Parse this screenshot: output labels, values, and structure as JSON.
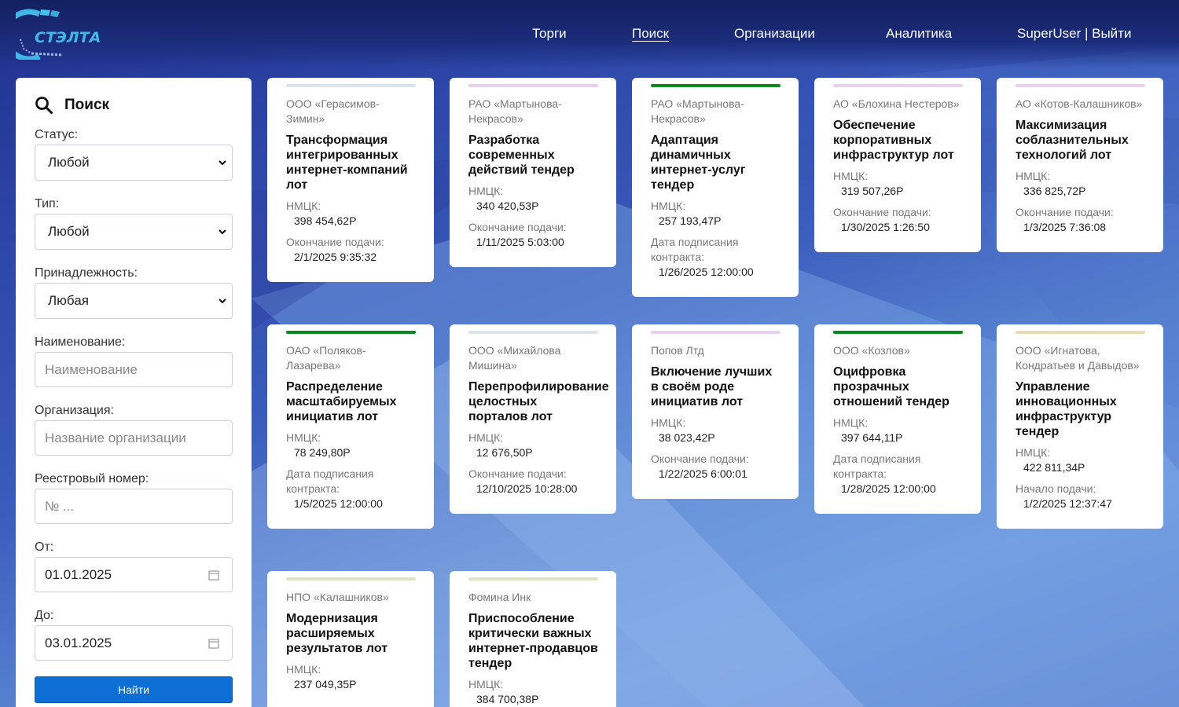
{
  "brand": {
    "name": "СТЭЛТА"
  },
  "nav": {
    "items": [
      "Торги",
      "Поиск",
      "Организации",
      "Аналитика",
      "SuperUser | Выйти"
    ],
    "active": "Поиск"
  },
  "search": {
    "title": "Поиск",
    "status_label": "Статус:",
    "status_value": "Любой",
    "type_label": "Тип:",
    "type_value": "Любой",
    "affiliation_label": "Принадлежность:",
    "affiliation_value": "Любая",
    "name_label": "Наименование:",
    "name_placeholder": "Наименование",
    "org_label": "Организация:",
    "org_placeholder": "Название организации",
    "reg_label": "Реестровый номер:",
    "reg_placeholder": "№ ...",
    "from_label": "От:",
    "from_value": "01.01.2025",
    "to_label": "До:",
    "to_value": "03.01.2025",
    "submit": "Найти"
  },
  "cards": [
    {
      "bar_color": "#dbe3ec",
      "org": "ООО «Герасимов-Зимин»",
      "title": "Трансформация интегрированных интернет-компаний лот",
      "price_label": "НМЦК:",
      "price": "398 454,62Р",
      "date_label": "Окончание подачи:",
      "date": "2/1/2025 9:35:32"
    },
    {
      "bar_color": "#e6d0ec",
      "org": "РАО «Мартынова-Некрасов»",
      "title": "Разработка современных действий тендер",
      "price_label": "НМЦК:",
      "price": "340 420,53Р",
      "date_label": "Окончание подачи:",
      "date": "1/11/2025 5:03:00"
    },
    {
      "bar_color": "#0a8a1e",
      "org": "РАО «Мартынова-Некрасов»",
      "title": "Адаптация динамичных интернет-услуг тендер",
      "price_label": "НМЦК:",
      "price": "257 193,47Р",
      "date_label": "Дата подписания контракта:",
      "date": "1/26/2025 12:00:00"
    },
    {
      "bar_color": "#e6d0ec",
      "org": "АО «Блохина Нестеров»",
      "title": "Обеспечение корпоративных инфраструктур лот",
      "price_label": "НМЦК:",
      "price": "319 507,26Р",
      "date_label": "Окончание подачи:",
      "date": "1/30/2025 1:26:50"
    },
    {
      "bar_color": "#e6d0ec",
      "org": "АО «Котов-Калашников»",
      "title": "Максимизация соблазнительных технологий лот",
      "price_label": "НМЦК:",
      "price": "336 825,72Р",
      "date_label": "Окончание подачи:",
      "date": "1/3/2025 7:36:08"
    },
    {
      "bar_color": "#0a8a1e",
      "org": "ОАО «Поляков-Лазарева»",
      "title": "Распределение масштабируемых инициатив лот",
      "price_label": "НМЦК:",
      "price": "78 249,80Р",
      "date_label": "Дата подписания контракта:",
      "date": "1/5/2025 12:00:00"
    },
    {
      "bar_color": "#dbe3ec",
      "org": "ООО «Михайлова Мишина»",
      "title": "Перепрофилирование целостных порталов лот",
      "price_label": "НМЦК:",
      "price": "12 676,50Р",
      "date_label": "Окончание подачи:",
      "date": "12/10/2025 10:28:00"
    },
    {
      "bar_color": "#e6d0ec",
      "org": "Попов Лтд",
      "title": "Включение лучших в своём роде инициатив лот",
      "price_label": "НМЦК:",
      "price": "38 023,42Р",
      "date_label": "Окончание подачи:",
      "date": "1/22/2025 6:00:01"
    },
    {
      "bar_color": "#0a8a1e",
      "org": "ООО «Козлов»",
      "title": "Оцифровка прозрачных отношений тендер",
      "price_label": "НМЦК:",
      "price": "397 644,11Р",
      "date_label": "Дата подписания контракта:",
      "date": "1/28/2025 12:00:00"
    },
    {
      "bar_color": "#e6dcb4",
      "org": "ООО «Игнатова, Кондратьев и Давыдов»",
      "title": "Управление инновационных инфраструктур тендер",
      "price_label": "НМЦК:",
      "price": "422 811,34Р",
      "date_label": "Начало подачи:",
      "date": "1/2/2025 12:37:47"
    },
    {
      "bar_color": "#dde6c0",
      "org": "НПО «Калашников»",
      "title": "Модернизация расширяемых результатов лот",
      "price_label": "НМЦК:",
      "price": "237 049,35Р",
      "date_label": "",
      "date": ""
    },
    {
      "bar_color": "#dde6c0",
      "org": "Фомина Инк",
      "title": "Приспособление критически важных интернет-продавцов тендер",
      "price_label": "НМЦК:",
      "price": "384 700,38Р",
      "date_label": "",
      "date": ""
    }
  ]
}
